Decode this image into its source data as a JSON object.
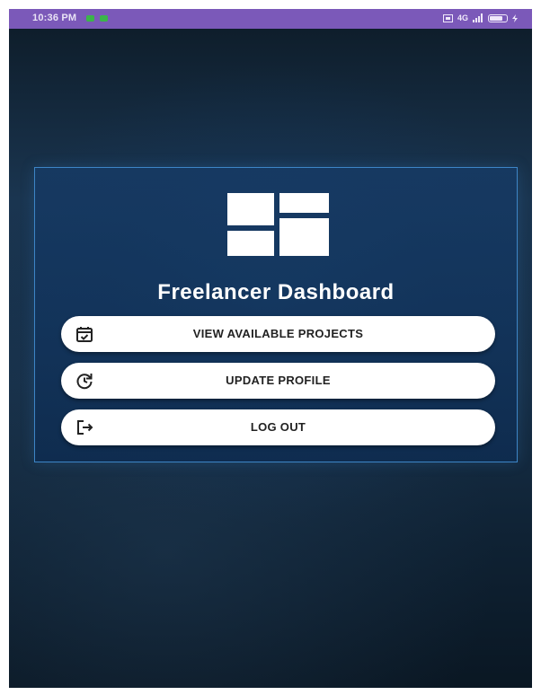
{
  "status_bar": {
    "time": "10:36 PM",
    "notification_icons": [
      "chat-notification-icon",
      "chat-notification-icon"
    ],
    "system_icons": [
      "sim-icon",
      "signal-icon",
      "battery-icon"
    ],
    "network_label": "4G",
    "battery_level": 0.85
  },
  "app": {
    "logo_icon": "dashboard-grid-icon",
    "title": "Freelancer Dashboard"
  },
  "buttons": [
    {
      "label": "VIEW AVAILABLE PROJECTS",
      "icon": "calendar-check-icon"
    },
    {
      "label": "UPDATE PROFILE",
      "icon": "refresh-clock-icon"
    },
    {
      "label": "LOG OUT",
      "icon": "logout-icon"
    }
  ],
  "colors": {
    "status_bar": "#7b59b9",
    "card_border": "#3d85c6",
    "button_bg": "#ffffff",
    "title_text": "#ffffff"
  }
}
